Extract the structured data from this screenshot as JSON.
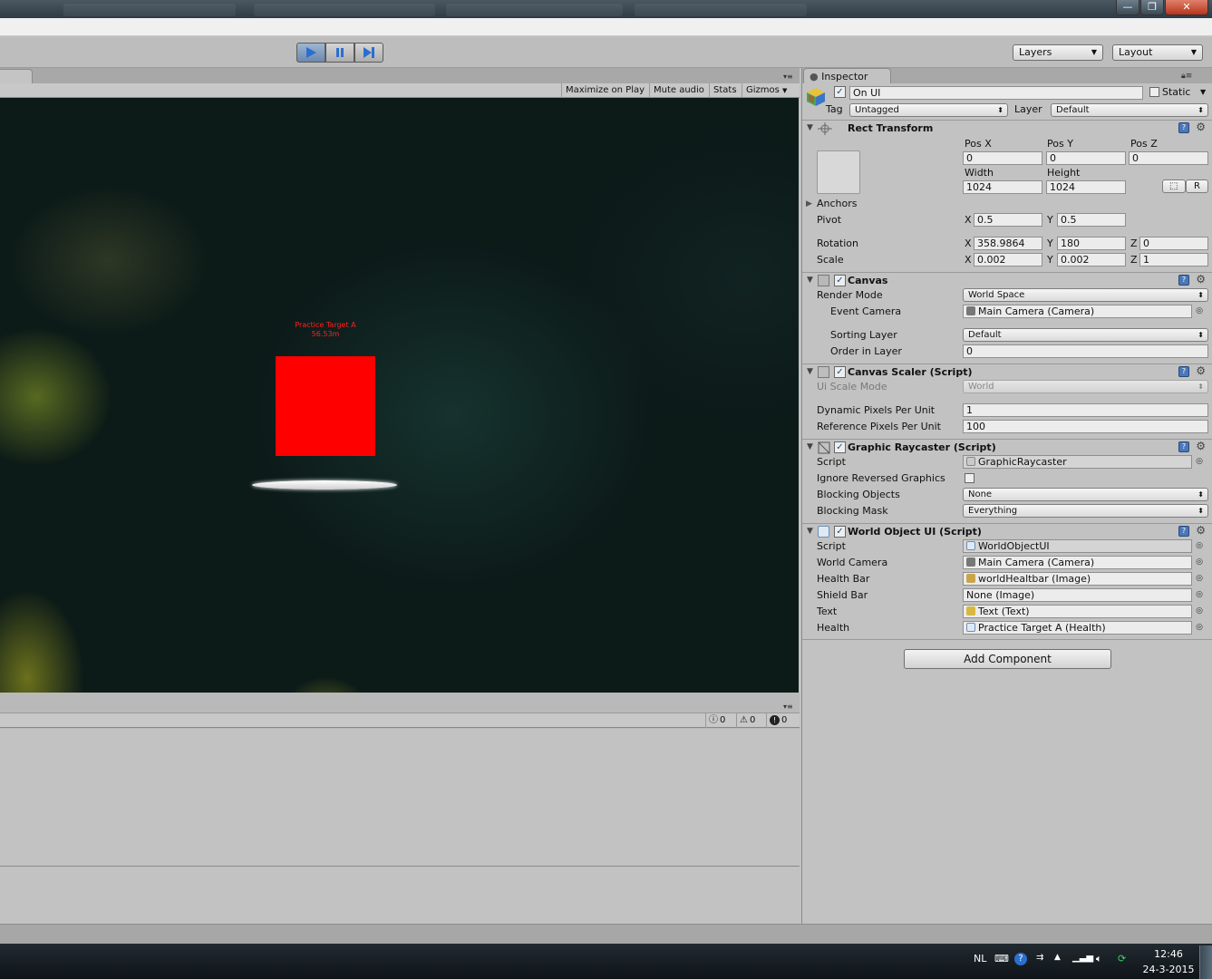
{
  "window": {
    "buttons": {
      "minimize": "—",
      "maximize": "❐",
      "close": "✕"
    }
  },
  "toolbar": {
    "layers_label": "Layers",
    "layout_label": "Layout",
    "play_icon": "play-icon",
    "pause_icon": "pause-icon",
    "step_icon": "step-icon",
    "accent": "#3b7bd0"
  },
  "game": {
    "buttons": {
      "maximize_on_play": "Maximize on Play",
      "mute_audio": "Mute audio",
      "stats": "Stats",
      "gizmos": "Gizmos"
    },
    "target_label": "Practice Target A",
    "target_distance": "56.53m",
    "target_color": "#ff0000"
  },
  "console": {
    "info_count": "0",
    "warn_count": "0",
    "error_count": "0"
  },
  "inspector": {
    "tab": "Inspector",
    "object_name": "On UI",
    "static_label": "Static",
    "tag_label": "Tag",
    "tag_value": "Untagged",
    "layer_label": "Layer",
    "layer_value": "Default",
    "rect_transform": {
      "title": "Rect Transform",
      "posx_label": "Pos X",
      "posy_label": "Pos Y",
      "posz_label": "Pos Z",
      "posx": "0",
      "posy": "0",
      "posz": "0",
      "width_label": "Width",
      "height_label": "Height",
      "width": "1024",
      "height": "1024",
      "r_button": "R",
      "anchors_label": "Anchors",
      "pivot_label": "Pivot",
      "pivot_x": "0.5",
      "pivot_y": "0.5",
      "rotation_label": "Rotation",
      "rot_x": "358.9864",
      "rot_y": "180",
      "rot_z": "0",
      "scale_label": "Scale",
      "scale_x": "0.002",
      "scale_y": "0.002",
      "scale_z": "1",
      "x": "X",
      "y": "Y",
      "z": "Z"
    },
    "canvas": {
      "title": "Canvas",
      "render_mode_label": "Render Mode",
      "render_mode": "World Space",
      "event_camera_label": "Event Camera",
      "event_camera": "Main Camera (Camera)",
      "sorting_layer_label": "Sorting Layer",
      "sorting_layer": "Default",
      "order_label": "Order in Layer",
      "order": "0"
    },
    "canvas_scaler": {
      "title": "Canvas Scaler (Script)",
      "ui_scale_mode_label": "Ui Scale Mode",
      "ui_scale_mode": "World",
      "dpu_label": "Dynamic Pixels Per Unit",
      "dpu": "1",
      "rppu_label": "Reference Pixels Per Unit",
      "rppu": "100"
    },
    "raycaster": {
      "title": "Graphic Raycaster (Script)",
      "script_label": "Script",
      "script": "GraphicRaycaster",
      "ignore_label": "Ignore Reversed Graphics",
      "blocking_objects_label": "Blocking Objects",
      "blocking_objects": "None",
      "blocking_mask_label": "Blocking Mask",
      "blocking_mask": "Everything"
    },
    "world_object_ui": {
      "title": "World Object UI (Script)",
      "script_label": "Script",
      "script": "WorldObjectUI",
      "world_camera_label": "World Camera",
      "world_camera": "Main Camera (Camera)",
      "health_bar_label": "Health Bar",
      "health_bar": "worldHealtbar (Image)",
      "shield_bar_label": "Shield Bar",
      "shield_bar": "None (Image)",
      "text_label": "Text",
      "text": "Text (Text)",
      "health_label": "Health",
      "health": "Practice Target A (Health)"
    },
    "add_component": "Add Component"
  },
  "taskbar": {
    "language": "NL",
    "time": "12:46",
    "date": "24-3-2015"
  }
}
